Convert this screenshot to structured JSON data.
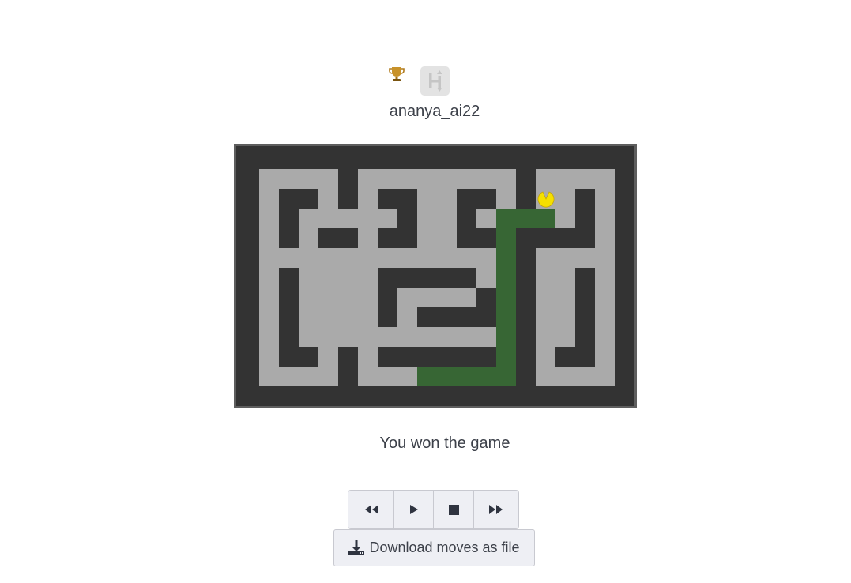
{
  "player": {
    "username": "ananya_ai22",
    "trophy_icon": "trophy-icon",
    "avatar_icon": "h-logo-icon"
  },
  "game": {
    "status_text": "You won the game",
    "wall_color": "#333333",
    "floor_color": "#aaaaaa",
    "path_color": "#376634",
    "player_color": "#f5e000"
  },
  "controls": {
    "rewind_icon": "rewind-icon",
    "play_icon": "play-icon",
    "stop_icon": "stop-icon",
    "fast_forward_icon": "fast-forward-icon"
  },
  "download": {
    "label": "Download moves as file",
    "icon": "download-icon"
  }
}
